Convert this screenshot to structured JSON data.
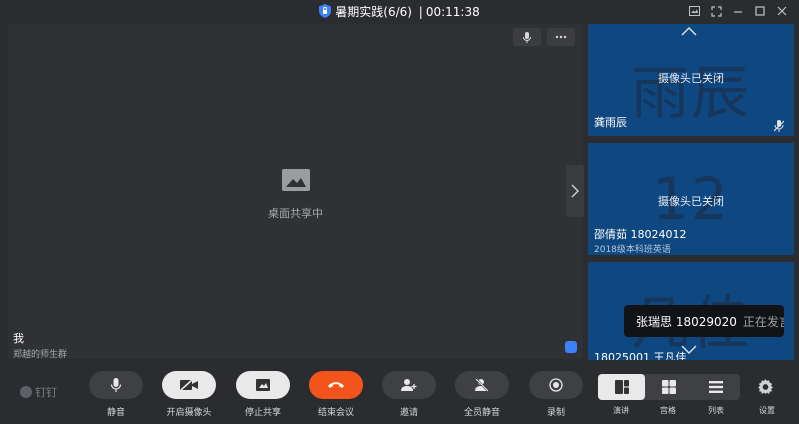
{
  "titlebar": {
    "meeting_title": "暑期实践(6/6)",
    "separator": "|",
    "timer": "00:11:38"
  },
  "stage": {
    "share_status": "桌面共享中",
    "presenter_name": "我",
    "presenter_group": "郑越的师生群"
  },
  "participants": [
    {
      "avatar_text": "雨辰",
      "camera_status": "摄像头已关闭",
      "name": "龚雨辰",
      "subtitle": ""
    },
    {
      "avatar_text": "12",
      "camera_status": "摄像头已关闭",
      "name": "邵倩茹 18024012",
      "subtitle": "2018级本科班英语"
    },
    {
      "avatar_text": "凡佳",
      "camera_status": "",
      "name": "18025001 王凡佳",
      "subtitle": ""
    }
  ],
  "toast": {
    "speaker": "张瑞思 18029020",
    "status": "正在发言"
  },
  "toolbar": {
    "brand": "钉钉",
    "mute": "静音",
    "camera": "开启摄像头",
    "stop_share": "停止共享",
    "end_meeting": "结束会议",
    "invite": "邀请",
    "mute_all": "全员静音",
    "record": "录制",
    "view_speaker": "演讲",
    "view_grid": "宫格",
    "view_list": "列表",
    "settings": "设置"
  },
  "colors": {
    "end_meeting": "#f2541b",
    "tile_bg": "#0f4880",
    "accent": "#3b82f6"
  }
}
